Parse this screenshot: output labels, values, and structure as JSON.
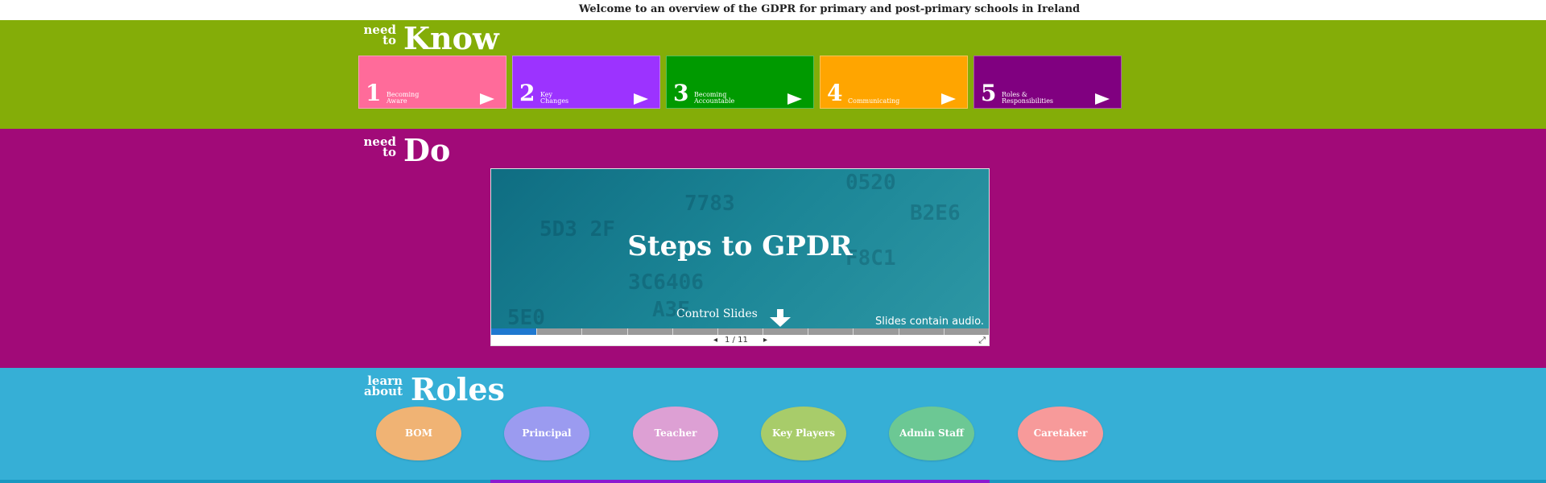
{
  "header": {
    "welcome_text": "Welcome to an overview of the GDPR for primary and post-primary schools in Ireland"
  },
  "know": {
    "heading_small_1": "need",
    "heading_small_2": "to",
    "heading_big": "Know",
    "tiles": [
      {
        "number": "1",
        "label_line1": "Becoming",
        "label_line2": "Aware",
        "color": "#ff6b9a"
      },
      {
        "number": "2",
        "label_line1": "Key",
        "label_line2": "Changes",
        "color": "#9c33ff"
      },
      {
        "number": "3",
        "label_line1": "Becoming",
        "label_line2": "Accountable",
        "color": "#009a00"
      },
      {
        "number": "4",
        "label_line1": "",
        "label_line2": "Communicating",
        "color": "#ffa500"
      },
      {
        "number": "5",
        "label_line1": "Roles &",
        "label_line2": "Responsibilities",
        "color": "#800080"
      }
    ]
  },
  "do": {
    "heading_small_1": "need",
    "heading_small_2": "to",
    "heading_big": "Do",
    "slideshow": {
      "title": "Steps to GPDR",
      "control_text": "Control Slides",
      "audio_note": "Slides contain audio.",
      "prev_symbol": "◂",
      "counter": "1 / 11",
      "next_symbol": "▸",
      "expand_symbol": "⤢",
      "progress_fraction": 0.09,
      "total_slides": 11,
      "bg_digits": [
        "0520",
        "7783",
        "B2E6",
        "5D3 2F",
        "3C6406",
        "F8C1",
        "A3E",
        "5E0"
      ]
    }
  },
  "roles": {
    "heading_small_1": "learn",
    "heading_small_2": "about",
    "heading_big": "Roles",
    "items": [
      {
        "label": "BOM",
        "color": "#f0b374"
      },
      {
        "label": "Principal",
        "color": "#9b9bf0"
      },
      {
        "label": "Teacher",
        "color": "#dda0d4"
      },
      {
        "label": "Key Players",
        "color": "#a8cc6a"
      },
      {
        "label": "Admin Staff",
        "color": "#6cc894"
      },
      {
        "label": "Caretaker",
        "color": "#f79a9a"
      }
    ]
  }
}
